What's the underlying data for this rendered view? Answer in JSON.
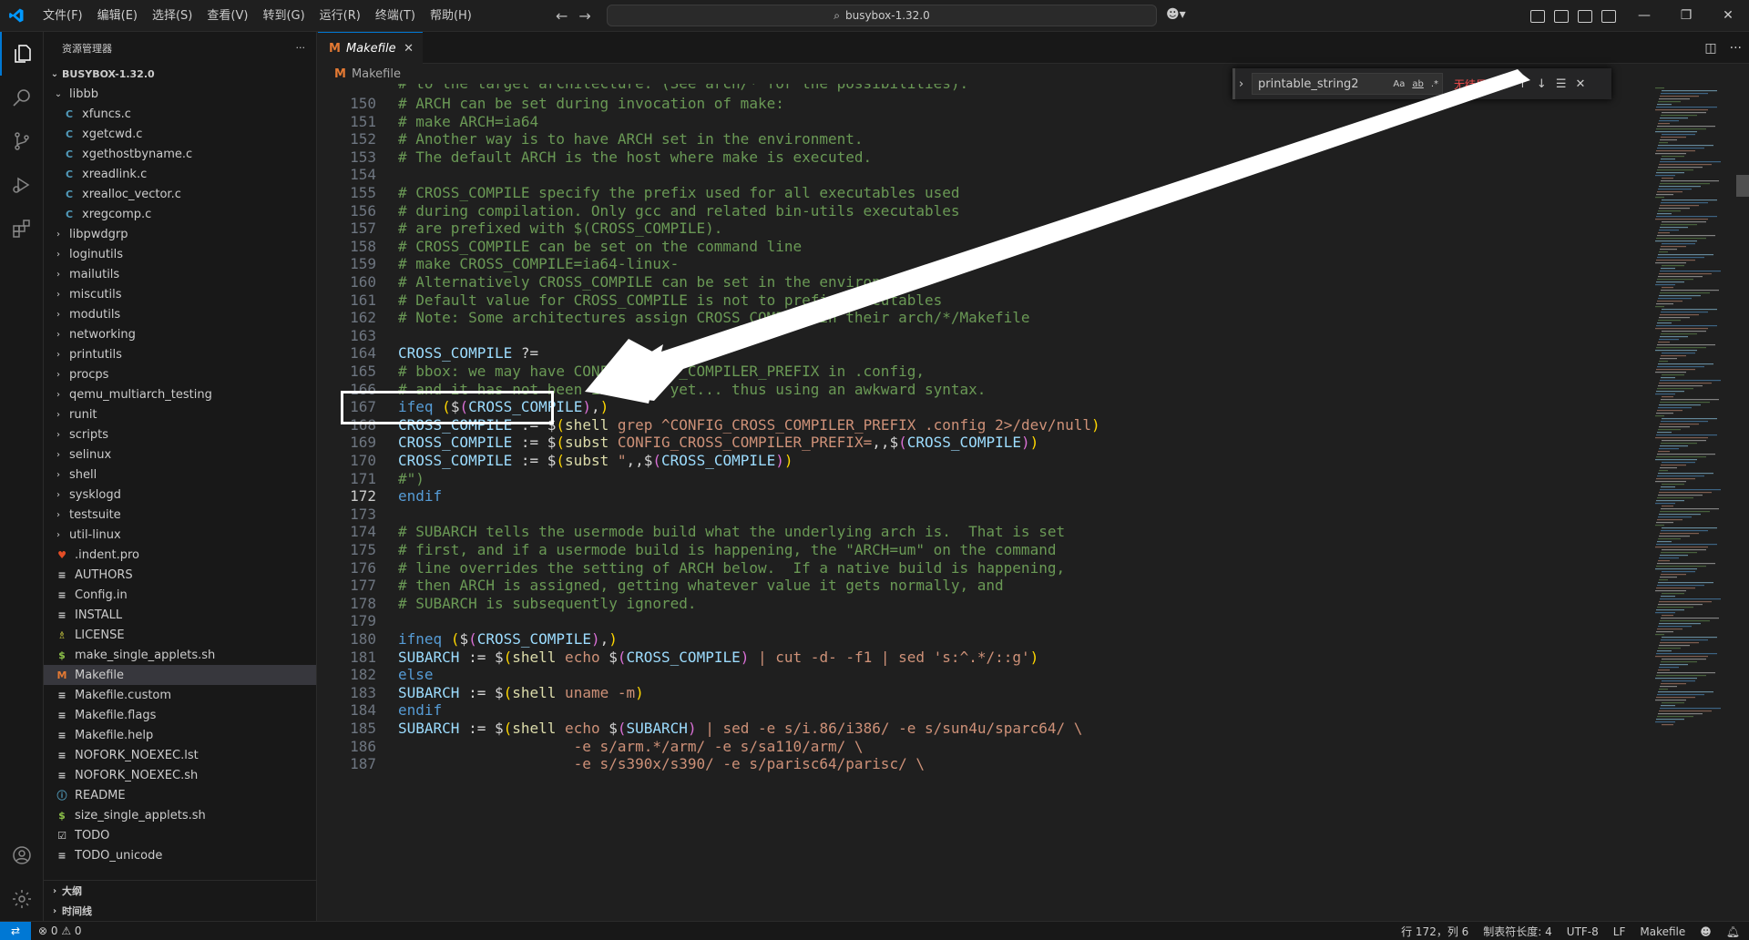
{
  "titlebar": {
    "menu": [
      "文件(F)",
      "编辑(E)",
      "选择(S)",
      "查看(V)",
      "转到(G)",
      "运行(R)",
      "终端(T)",
      "帮助(H)"
    ],
    "search_text": "busybox-1.32.0"
  },
  "sidebar": {
    "title": "资源管理器",
    "more": "···",
    "root": "BUSYBOX-1.32.0",
    "items": [
      {
        "label": "libbb",
        "kind": "folder-open",
        "indent": 1
      },
      {
        "label": "xfuncs.c",
        "kind": "c",
        "indent": 2
      },
      {
        "label": "xgetcwd.c",
        "kind": "c",
        "indent": 2
      },
      {
        "label": "xgethostbyname.c",
        "kind": "c",
        "indent": 2
      },
      {
        "label": "xreadlink.c",
        "kind": "c",
        "indent": 2
      },
      {
        "label": "xrealloc_vector.c",
        "kind": "c",
        "indent": 2
      },
      {
        "label": "xregcomp.c",
        "kind": "c",
        "indent": 2
      },
      {
        "label": "libpwdgrp",
        "kind": "folder",
        "indent": 1
      },
      {
        "label": "loginutils",
        "kind": "folder",
        "indent": 1
      },
      {
        "label": "mailutils",
        "kind": "folder",
        "indent": 1
      },
      {
        "label": "miscutils",
        "kind": "folder",
        "indent": 1
      },
      {
        "label": "modutils",
        "kind": "folder",
        "indent": 1
      },
      {
        "label": "networking",
        "kind": "folder",
        "indent": 1
      },
      {
        "label": "printutils",
        "kind": "folder",
        "indent": 1
      },
      {
        "label": "procps",
        "kind": "folder",
        "indent": 1
      },
      {
        "label": "qemu_multiarch_testing",
        "kind": "folder",
        "indent": 1
      },
      {
        "label": "runit",
        "kind": "folder",
        "indent": 1
      },
      {
        "label": "scripts",
        "kind": "folder",
        "indent": 1
      },
      {
        "label": "selinux",
        "kind": "folder",
        "indent": 1
      },
      {
        "label": "shell",
        "kind": "folder",
        "indent": 1
      },
      {
        "label": "sysklogd",
        "kind": "folder",
        "indent": 1
      },
      {
        "label": "testsuite",
        "kind": "folder",
        "indent": 1
      },
      {
        "label": "util-linux",
        "kind": "folder",
        "indent": 1
      },
      {
        "label": ".indent.pro",
        "kind": "pro",
        "indent": 1
      },
      {
        "label": "AUTHORS",
        "kind": "text",
        "indent": 1
      },
      {
        "label": "Config.in",
        "kind": "text",
        "indent": 1
      },
      {
        "label": "INSTALL",
        "kind": "text",
        "indent": 1
      },
      {
        "label": "LICENSE",
        "kind": "license",
        "indent": 1
      },
      {
        "label": "make_single_applets.sh",
        "kind": "sh",
        "indent": 1
      },
      {
        "label": "Makefile",
        "kind": "make",
        "indent": 1,
        "selected": true
      },
      {
        "label": "Makefile.custom",
        "kind": "text",
        "indent": 1
      },
      {
        "label": "Makefile.flags",
        "kind": "text",
        "indent": 1
      },
      {
        "label": "Makefile.help",
        "kind": "text",
        "indent": 1
      },
      {
        "label": "NOFORK_NOEXEC.lst",
        "kind": "text",
        "indent": 1
      },
      {
        "label": "NOFORK_NOEXEC.sh",
        "kind": "text",
        "indent": 1
      },
      {
        "label": "README",
        "kind": "info",
        "indent": 1
      },
      {
        "label": "size_single_applets.sh",
        "kind": "sh",
        "indent": 1
      },
      {
        "label": "TODO",
        "kind": "todo",
        "indent": 1
      },
      {
        "label": "TODO_unicode",
        "kind": "text",
        "indent": 1
      }
    ],
    "outline": "大纲",
    "timeline": "时间线"
  },
  "editor": {
    "tab_label": "Makefile",
    "tab_close": "✕",
    "breadcrumb": "Makefile",
    "find": {
      "query": "printable_string2",
      "opt_case": "Aa",
      "opt_word": "ab",
      "opt_regex": ".*",
      "result": "无结果"
    },
    "partial_top": "# to the target architecture. (See arch/* for the possibilities).",
    "lines": [
      {
        "n": "150",
        "t": [
          [
            "c-com",
            "# ARCH can be set during invocation of make:"
          ]
        ]
      },
      {
        "n": "151",
        "t": [
          [
            "c-com",
            "# make ARCH=ia64"
          ]
        ]
      },
      {
        "n": "152",
        "t": [
          [
            "c-com",
            "# Another way is to have ARCH set in the environment."
          ]
        ]
      },
      {
        "n": "153",
        "t": [
          [
            "c-com",
            "# The default ARCH is the host where make is executed."
          ]
        ]
      },
      {
        "n": "154",
        "t": []
      },
      {
        "n": "155",
        "t": [
          [
            "c-com",
            "# CROSS_COMPILE specify the prefix used for all executables used"
          ]
        ]
      },
      {
        "n": "156",
        "t": [
          [
            "c-com",
            "# during compilation. Only gcc and related bin-utils executables"
          ]
        ]
      },
      {
        "n": "157",
        "t": [
          [
            "c-com",
            "# are prefixed with $(CROSS_COMPILE)."
          ]
        ]
      },
      {
        "n": "158",
        "t": [
          [
            "c-com",
            "# CROSS_COMPILE can be set on the command line"
          ]
        ]
      },
      {
        "n": "159",
        "t": [
          [
            "c-com",
            "# make CROSS_COMPILE=ia64-linux-"
          ]
        ]
      },
      {
        "n": "160",
        "t": [
          [
            "c-com",
            "# Alternatively CROSS_COMPILE can be set in the environment."
          ]
        ]
      },
      {
        "n": "161",
        "t": [
          [
            "c-com",
            "# Default value for CROSS_COMPILE is not to prefix executables"
          ]
        ]
      },
      {
        "n": "162",
        "t": [
          [
            "c-com",
            "# Note: Some architectures assign CROSS_COMPILE in their arch/*/Makefile"
          ]
        ]
      },
      {
        "n": "163",
        "t": []
      },
      {
        "n": "164",
        "t": [
          [
            "c-var",
            "CROSS_COMPILE"
          ],
          [
            "c-op",
            " ?="
          ]
        ]
      },
      {
        "n": "165",
        "t": [
          [
            "c-com",
            "# bbox: we may have CONFIG_CROSS_COMPILER_PREFIX in .config,"
          ]
        ]
      },
      {
        "n": "166",
        "t": [
          [
            "c-com",
            "# and it has not been included yet... thus using an awkward syntax."
          ]
        ]
      },
      {
        "n": "167",
        "t": [
          [
            "c-kw",
            "ifeq"
          ],
          [
            "c-op",
            " "
          ],
          [
            "c-br",
            "("
          ],
          [
            "c-op",
            "$"
          ],
          [
            "c-br2",
            "("
          ],
          [
            "c-var",
            "CROSS_COMPILE"
          ],
          [
            "c-br2",
            ")"
          ],
          [
            "c-op",
            ","
          ],
          [
            "c-br",
            ")"
          ]
        ]
      },
      {
        "n": "168",
        "t": [
          [
            "c-var",
            "CROSS_COMPILE"
          ],
          [
            "c-op",
            " := $"
          ],
          [
            "c-br",
            "("
          ],
          [
            "c-fn",
            "shell"
          ],
          [
            "c-str",
            " grep ^CONFIG_CROSS_COMPILER_PREFIX .config 2>/dev/null"
          ],
          [
            "c-br",
            ")"
          ]
        ]
      },
      {
        "n": "169",
        "t": [
          [
            "c-var",
            "CROSS_COMPILE"
          ],
          [
            "c-op",
            " := $"
          ],
          [
            "c-br",
            "("
          ],
          [
            "c-fn",
            "subst"
          ],
          [
            "c-str",
            " CONFIG_CROSS_COMPILER_PREFIX="
          ],
          [
            "c-op",
            ",,$"
          ],
          [
            "c-br2",
            "("
          ],
          [
            "c-var",
            "CROSS_COMPILE"
          ],
          [
            "c-br2",
            ")"
          ],
          [
            "c-br",
            ")"
          ]
        ]
      },
      {
        "n": "170",
        "t": [
          [
            "c-var",
            "CROSS_COMPILE"
          ],
          [
            "c-op",
            " := $"
          ],
          [
            "c-br",
            "("
          ],
          [
            "c-fn",
            "subst"
          ],
          [
            "c-str",
            " \""
          ],
          [
            "c-op",
            ",,$"
          ],
          [
            "c-br2",
            "("
          ],
          [
            "c-var",
            "CROSS_COMPILE"
          ],
          [
            "c-br2",
            ")"
          ],
          [
            "c-br",
            ")"
          ]
        ]
      },
      {
        "n": "171",
        "t": [
          [
            "c-com",
            "#\")"
          ]
        ]
      },
      {
        "n": "172",
        "t": [
          [
            "c-kw",
            "endif"
          ]
        ],
        "current": true
      },
      {
        "n": "173",
        "t": []
      },
      {
        "n": "174",
        "t": [
          [
            "c-com",
            "# SUBARCH tells the usermode build what the underlying arch is.  That is set"
          ]
        ]
      },
      {
        "n": "175",
        "t": [
          [
            "c-com",
            "# first, and if a usermode build is happening, the \"ARCH=um\" on the command"
          ]
        ]
      },
      {
        "n": "176",
        "t": [
          [
            "c-com",
            "# line overrides the setting of ARCH below.  If a native build is happening,"
          ]
        ]
      },
      {
        "n": "177",
        "t": [
          [
            "c-com",
            "# then ARCH is assigned, getting whatever value it gets normally, and"
          ]
        ]
      },
      {
        "n": "178",
        "t": [
          [
            "c-com",
            "# SUBARCH is subsequently ignored."
          ]
        ]
      },
      {
        "n": "179",
        "t": []
      },
      {
        "n": "180",
        "t": [
          [
            "c-kw",
            "ifneq"
          ],
          [
            "c-op",
            " "
          ],
          [
            "c-br",
            "("
          ],
          [
            "c-op",
            "$"
          ],
          [
            "c-br2",
            "("
          ],
          [
            "c-var",
            "CROSS_COMPILE"
          ],
          [
            "c-br2",
            ")"
          ],
          [
            "c-op",
            ","
          ],
          [
            "c-br",
            ")"
          ]
        ]
      },
      {
        "n": "181",
        "t": [
          [
            "c-var",
            "SUBARCH"
          ],
          [
            "c-op",
            " := $"
          ],
          [
            "c-br",
            "("
          ],
          [
            "c-fn",
            "shell"
          ],
          [
            "c-str",
            " echo "
          ],
          [
            "c-op",
            "$"
          ],
          [
            "c-br2",
            "("
          ],
          [
            "c-var",
            "CROSS_COMPILE"
          ],
          [
            "c-br2",
            ")"
          ],
          [
            "c-str",
            " | cut -d- -f1 | sed 's:^.*/::g'"
          ],
          [
            "c-br",
            ")"
          ]
        ]
      },
      {
        "n": "182",
        "t": [
          [
            "c-kw",
            "else"
          ]
        ]
      },
      {
        "n": "183",
        "t": [
          [
            "c-var",
            "SUBARCH"
          ],
          [
            "c-op",
            " := $"
          ],
          [
            "c-br",
            "("
          ],
          [
            "c-fn",
            "shell"
          ],
          [
            "c-str",
            " uname -m"
          ],
          [
            "c-br",
            ")"
          ]
        ]
      },
      {
        "n": "184",
        "t": [
          [
            "c-kw",
            "endif"
          ]
        ]
      },
      {
        "n": "185",
        "t": [
          [
            "c-var",
            "SUBARCH"
          ],
          [
            "c-op",
            " := $"
          ],
          [
            "c-br",
            "("
          ],
          [
            "c-fn",
            "shell"
          ],
          [
            "c-str",
            " echo "
          ],
          [
            "c-op",
            "$"
          ],
          [
            "c-br2",
            "("
          ],
          [
            "c-var",
            "SUBARCH"
          ],
          [
            "c-br2",
            ")"
          ],
          [
            "c-str",
            " | sed -e s/i.86/i386/ -e s/sun4u/sparc64/ \\"
          ]
        ]
      },
      {
        "n": "186",
        "t": [
          [
            "c-str",
            "                    -e s/arm.*/arm/ -e s/sa110/arm/ \\"
          ]
        ]
      },
      {
        "n": "187",
        "t": [
          [
            "c-str",
            "                    -e s/s390x/s390/ -e s/parisc64/parisc/ \\"
          ]
        ]
      }
    ]
  },
  "statusbar": {
    "problems": "⊗ 0 ⚠ 0",
    "position": "行 172，列 6",
    "tabsize": "制表符长度: 4",
    "encoding": "UTF-8",
    "eol": "LF",
    "language": "Makefile"
  },
  "colors": {
    "accent": "#0078d4",
    "background": "#1f1f1f",
    "sidebar": "#181818"
  }
}
